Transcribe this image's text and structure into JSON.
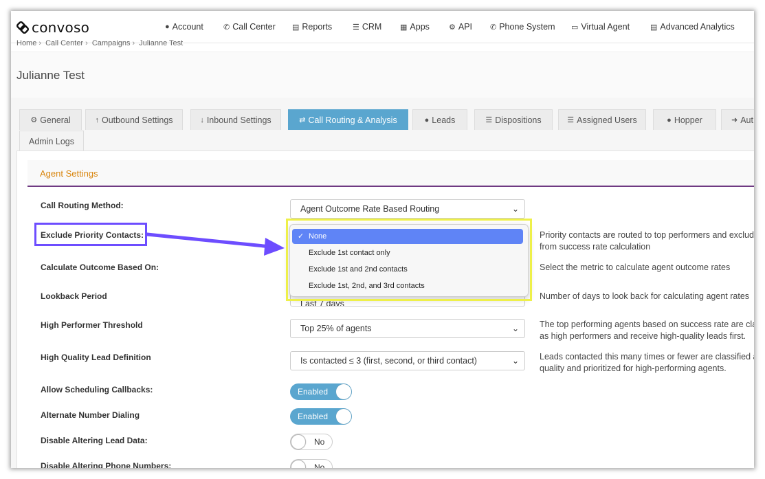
{
  "brand": {
    "name": "convoso"
  },
  "nav": [
    {
      "label": "Account",
      "icon": "user-icon"
    },
    {
      "label": "Call Center",
      "icon": "phone-icon"
    },
    {
      "label": "Reports",
      "icon": "bar-chart-icon"
    },
    {
      "label": "CRM",
      "icon": "list-icon"
    },
    {
      "label": "Apps",
      "icon": "grid-icon"
    },
    {
      "label": "API",
      "icon": "gear-icon"
    },
    {
      "label": "Phone System",
      "icon": "phone-icon"
    },
    {
      "label": "Virtual Agent",
      "icon": "monitor-icon"
    },
    {
      "label": "Advanced Analytics",
      "icon": "bar-chart-icon"
    }
  ],
  "breadcrumb": [
    "Home",
    "Call Center",
    "Campaigns",
    "Julianne Test"
  ],
  "page": {
    "title": "Julianne Test"
  },
  "tabs": [
    {
      "label": "General",
      "icon": "gears-icon"
    },
    {
      "label": "Outbound Settings",
      "icon": "arrow-up-icon"
    },
    {
      "label": "Inbound Settings",
      "icon": "arrow-down-icon"
    },
    {
      "label": "Call Routing & Analysis",
      "icon": "shuffle-icon",
      "active": true
    },
    {
      "label": "Leads",
      "icon": "users-icon"
    },
    {
      "label": "Dispositions",
      "icon": "list-icon"
    },
    {
      "label": "Assigned Users",
      "icon": "list-ol-icon"
    },
    {
      "label": "Hopper",
      "icon": "users-icon"
    },
    {
      "label": "Aut",
      "icon": "sign-out-icon"
    },
    {
      "label": "Admin Logs",
      "icon": ""
    }
  ],
  "section": {
    "title": "Agent Settings"
  },
  "settings": {
    "call_routing_method": {
      "label": "Call Routing Method:",
      "value": "Agent Outcome Rate Based Routing"
    },
    "exclude_priority": {
      "label": "Exclude Priority Contacts:",
      "help": "Priority contacts are routed to top performers and exclud from success rate calculation",
      "options": [
        "None",
        "Exclude 1st contact only",
        "Exclude 1st and 2nd contacts",
        "Exclude 1st, 2nd, and 3rd contacts"
      ],
      "selected": "None"
    },
    "calculate_outcome": {
      "label": "Calculate Outcome Based On:",
      "help": "Select the metric to calculate agent outcome rates"
    },
    "lookback": {
      "label": "Lookback Period",
      "value": "Last 7 days",
      "help": "Number of days to look back for calculating agent rates"
    },
    "high_performer": {
      "label": "High Performer Threshold",
      "value": "Top 25% of agents",
      "help": "The top performing agents based on success rate are clas as high performers and receive high-quality leads first."
    },
    "high_quality": {
      "label": "High Quality Lead Definition",
      "value": "Is contacted ≤ 3 (first, second, or third contact)",
      "help": "Leads contacted this many times or fewer are classified as quality and prioritized for high-performing agents."
    },
    "allow_callbacks": {
      "label": "Allow Scheduling Callbacks:",
      "value": "Enabled"
    },
    "alternate_dialing": {
      "label": "Alternate Number Dialing",
      "value": "Enabled"
    },
    "disable_lead_data": {
      "label": "Disable Altering Lead Data:",
      "value": "No"
    },
    "disable_phone": {
      "label": "Disable Altering Phone Numbers:",
      "value": "No"
    }
  },
  "colors": {
    "accent": "#5aa6cf",
    "section_title": "#d9860f",
    "annotation_purple": "#6d4dff",
    "annotation_yellow": "#eef04a",
    "option_selected": "#5f84f6"
  }
}
